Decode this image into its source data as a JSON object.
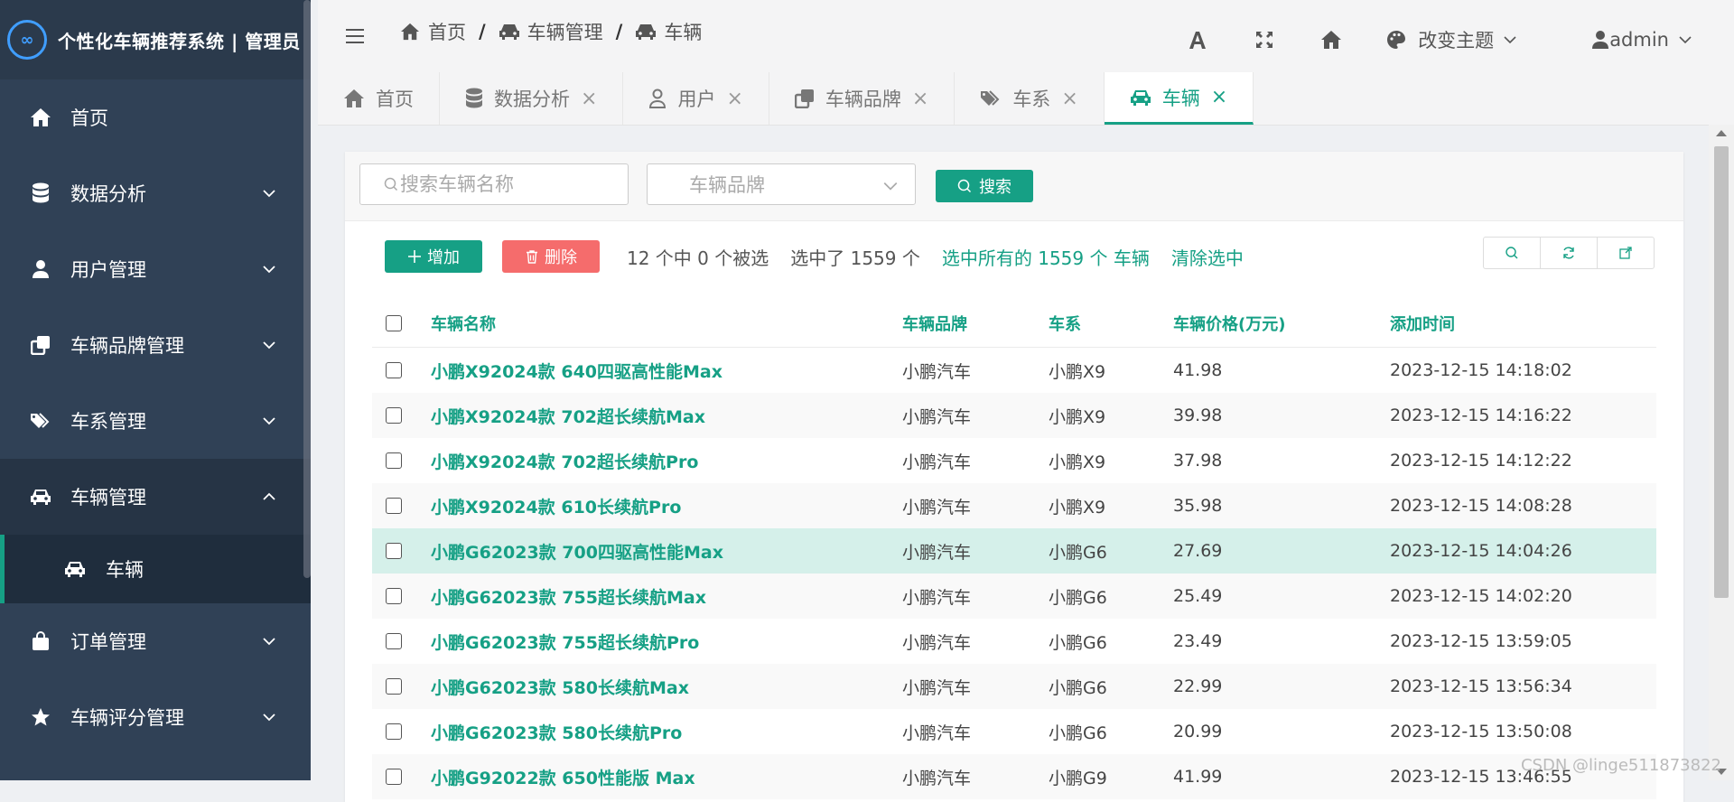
{
  "sidebar": {
    "title": "个性化车辆推荐系统 | 管理员",
    "logo_text": "∞",
    "menu": [
      {
        "label": "首页"
      },
      {
        "label": "数据分析"
      },
      {
        "label": "用户管理"
      },
      {
        "label": "车辆品牌管理"
      },
      {
        "label": "车系管理"
      },
      {
        "label": "车辆管理"
      },
      {
        "label": "订单管理"
      },
      {
        "label": "车辆评分管理"
      }
    ],
    "submenu_active": "车辆"
  },
  "topbar": {
    "breadcrumb": [
      "首页",
      "车辆管理",
      "车辆"
    ],
    "theme_label": "改变主题",
    "user_label": "admin"
  },
  "tabs": [
    {
      "label": "首页"
    },
    {
      "label": "数据分析"
    },
    {
      "label": "用户"
    },
    {
      "label": "车辆品牌"
    },
    {
      "label": "车系"
    },
    {
      "label": "车辆"
    }
  ],
  "search": {
    "name_placeholder": "搜索车辆名称",
    "brand_placeholder": "车辆品牌",
    "search_label": "搜索"
  },
  "actions": {
    "add_label": "增加",
    "delete_label": "删除",
    "count_text": "12 个中 0 个被选",
    "selected_text": "选中了 1559 个",
    "select_all_text": "选中所有的 1559 个 车辆",
    "clear_text": "清除选中"
  },
  "table": {
    "headers": [
      "车辆名称",
      "车辆品牌",
      "车系",
      "车辆价格(万元)",
      "添加时间"
    ],
    "rows": [
      {
        "name": "小鹏X92024款 640四驱高性能Max",
        "brand": "小鹏汽车",
        "series": "小鹏X9",
        "price": "41.98",
        "time": "2023-12-15 14:18:02"
      },
      {
        "name": "小鹏X92024款 702超长续航Max",
        "brand": "小鹏汽车",
        "series": "小鹏X9",
        "price": "39.98",
        "time": "2023-12-15 14:16:22"
      },
      {
        "name": "小鹏X92024款 702超长续航Pro",
        "brand": "小鹏汽车",
        "series": "小鹏X9",
        "price": "37.98",
        "time": "2023-12-15 14:12:22"
      },
      {
        "name": "小鹏X92024款 610长续航Pro",
        "brand": "小鹏汽车",
        "series": "小鹏X9",
        "price": "35.98",
        "time": "2023-12-15 14:08:28"
      },
      {
        "name": "小鹏G62023款 700四驱高性能Max",
        "brand": "小鹏汽车",
        "series": "小鹏G6",
        "price": "27.69",
        "time": "2023-12-15 14:04:26"
      },
      {
        "name": "小鹏G62023款 755超长续航Max",
        "brand": "小鹏汽车",
        "series": "小鹏G6",
        "price": "25.49",
        "time": "2023-12-15 14:02:20"
      },
      {
        "name": "小鹏G62023款 755超长续航Pro",
        "brand": "小鹏汽车",
        "series": "小鹏G6",
        "price": "23.49",
        "time": "2023-12-15 13:59:05"
      },
      {
        "name": "小鹏G62023款 580长续航Max",
        "brand": "小鹏汽车",
        "series": "小鹏G6",
        "price": "22.99",
        "time": "2023-12-15 13:56:34"
      },
      {
        "name": "小鹏G62023款 580长续航Pro",
        "brand": "小鹏汽车",
        "series": "小鹏G6",
        "price": "20.99",
        "time": "2023-12-15 13:50:08"
      },
      {
        "name": "小鹏G92022款 650性能版 Max",
        "brand": "小鹏汽车",
        "series": "小鹏G9",
        "price": "41.99",
        "time": "2023-12-15 13:46:55"
      }
    ]
  },
  "watermark": "CSDN @linge511873822",
  "colors": {
    "accent": "#16a085",
    "sidebar": "#304156",
    "danger": "#f56c6c",
    "highlight_row": "#d5f0ea"
  }
}
